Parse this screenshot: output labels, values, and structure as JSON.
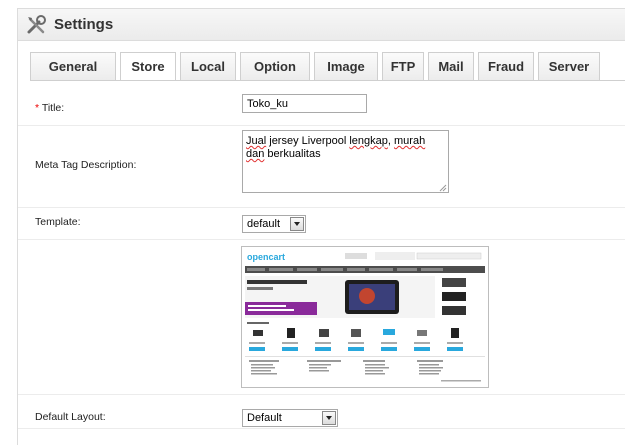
{
  "header": {
    "title": "Settings",
    "icon": "tools-icon"
  },
  "tabs": [
    {
      "label": "General"
    },
    {
      "label": "Store",
      "active": true
    },
    {
      "label": "Local"
    },
    {
      "label": "Option"
    },
    {
      "label": "Image"
    },
    {
      "label": "FTP"
    },
    {
      "label": "Mail"
    },
    {
      "label": "Fraud"
    },
    {
      "label": "Server"
    }
  ],
  "form": {
    "title": {
      "required_mark": "*",
      "label": "Title:",
      "value": "Toko_ku"
    },
    "meta": {
      "label": "Meta Tag Description:",
      "words": [
        {
          "t": "Jual",
          "sq": true
        },
        {
          "t": " jersey Liverpool "
        },
        {
          "t": "lengkap",
          "sq": true
        },
        {
          "t": ", "
        },
        {
          "t": "murah",
          "sq": true
        },
        {
          "t": " "
        },
        {
          "t": "dan",
          "sq": true
        },
        {
          "t": " berkualitas"
        }
      ]
    },
    "template": {
      "label": "Template:",
      "value": "default"
    },
    "layout": {
      "label": "Default Layout:",
      "value": "Default"
    }
  },
  "colors": {
    "accent_purple": "#8a2a9a",
    "preview_green": "#7cb342",
    "preview_blue": "#29a8dd"
  }
}
